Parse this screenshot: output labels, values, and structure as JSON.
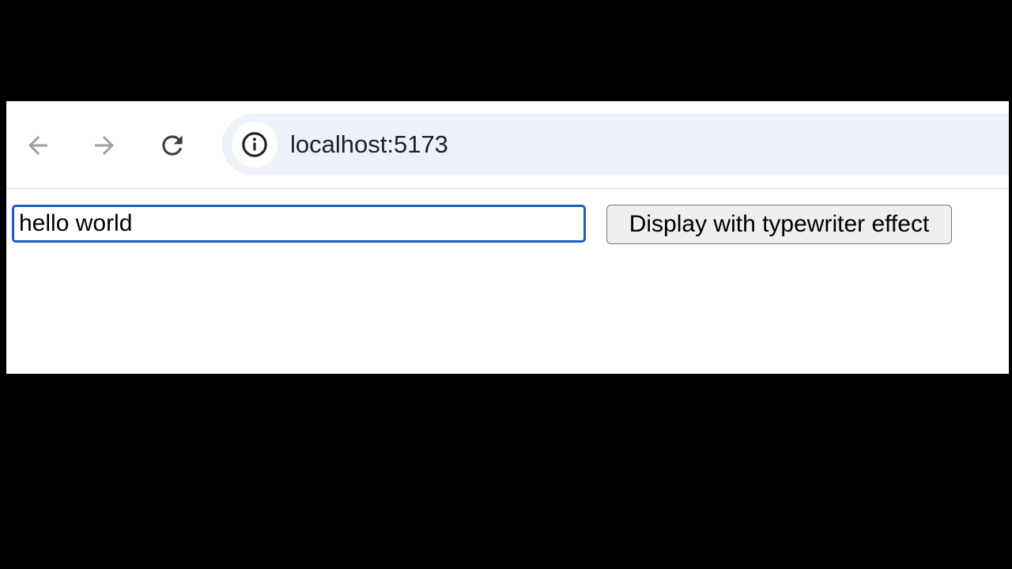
{
  "browser": {
    "url": "localhost:5173",
    "icons": {
      "back": "arrow-left-icon",
      "forward": "arrow-right-icon",
      "reload": "reload-icon",
      "site_info": "info-icon"
    }
  },
  "page": {
    "text_input": {
      "value": "hello world",
      "placeholder": ""
    },
    "display_button_label": "Display with typewriter effect"
  },
  "colors": {
    "omnibox_background": "#edf1f9",
    "input_focus_border": "#1a5fb4",
    "button_background": "#efefef",
    "disabled_icon": "#a0a0a0",
    "active_icon": "#3c4043"
  }
}
